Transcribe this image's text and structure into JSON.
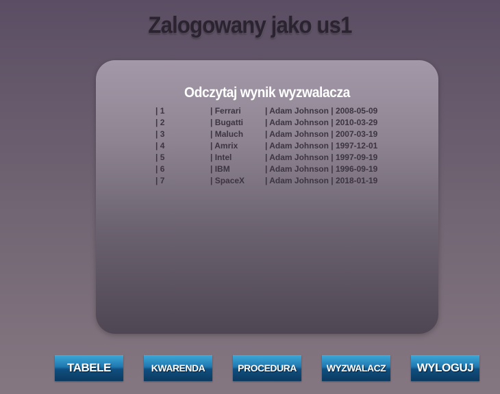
{
  "header": {
    "title": "Zalogowany jako us1"
  },
  "panel": {
    "title": "Odczytaj wynik wyzwalacza",
    "rows": [
      {
        "id": "| 1",
        "name": "| Ferrari",
        "user_date": "| Adam Johnson | 2008-05-09"
      },
      {
        "id": "| 2",
        "name": "| Bugatti",
        "user_date": "| Adam Johnson | 2010-03-29"
      },
      {
        "id": "| 3",
        "name": "| Maluch",
        "user_date": "| Adam Johnson | 2007-03-19"
      },
      {
        "id": "| 4",
        "name": "| Amrix",
        "user_date": "| Adam Johnson | 1997-12-01"
      },
      {
        "id": "| 5",
        "name": "| Intel",
        "user_date": "| Adam Johnson | 1997-09-19"
      },
      {
        "id": "| 6",
        "name": "| IBM",
        "user_date": "| Adam Johnson | 1996-09-19"
      },
      {
        "id": "| 7",
        "name": "| SpaceX",
        "user_date": "| Adam Johnson | 2018-01-19"
      }
    ]
  },
  "nav": {
    "tabele": "TABELE",
    "kwarenda": "KWARENDA",
    "procedura": "PROCEDURA",
    "wyzwalacz": "WYZWALACZ",
    "wyloguj": "WYLOGUJ"
  },
  "colors": {
    "button_top": "#3fa9d9",
    "button_bottom": "#0b3a60",
    "title_text": "#2b2430",
    "row_text": "#3c3440"
  }
}
